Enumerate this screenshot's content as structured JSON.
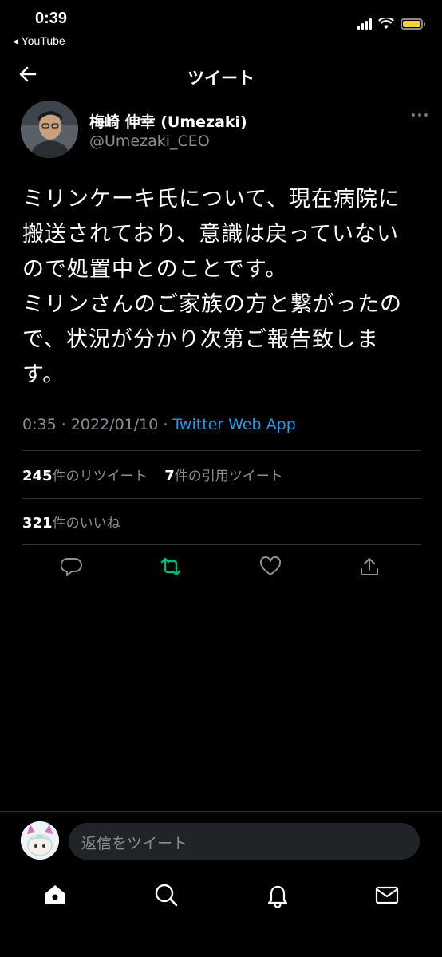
{
  "status_bar": {
    "time": "0:39",
    "back_app": "◂ YouTube"
  },
  "nav": {
    "title": "ツイート"
  },
  "author": {
    "name": "梅崎 伸幸 (Umezaki)",
    "handle": "@Umezaki_CEO"
  },
  "tweet": {
    "lines": [
      "ミリンケーキ氏について、現在病院に",
      "搬送されており、意識は戻っていない",
      "ので処置中とのことです。",
      "ミリンさんのご家族の方と繋がったの",
      "で、状況が分かり次第ご報告致しま",
      "す。"
    ],
    "time": "0:35",
    "separator": "·",
    "date": "2022/01/10",
    "source": "Twitter Web App"
  },
  "stats": {
    "retweets_count": "245",
    "retweets_label": "件のリツイート",
    "quotes_count": "7",
    "quotes_label": "件の引用ツイート",
    "likes_count": "321",
    "likes_label": "件のいいね"
  },
  "reply": {
    "placeholder": "返信をツイート"
  },
  "icons": {
    "reply": "reply-icon",
    "retweet": "retweet-icon",
    "like": "heart-icon",
    "share": "share-icon",
    "home": "home-icon",
    "search": "search-icon",
    "notifications": "bell-icon",
    "messages": "mail-icon"
  },
  "colors": {
    "background": "#000000",
    "accent": "#1d9bf0",
    "retweet_active": "#00ba7c",
    "muted": "#8b9096",
    "battery": "#f5d03b"
  }
}
